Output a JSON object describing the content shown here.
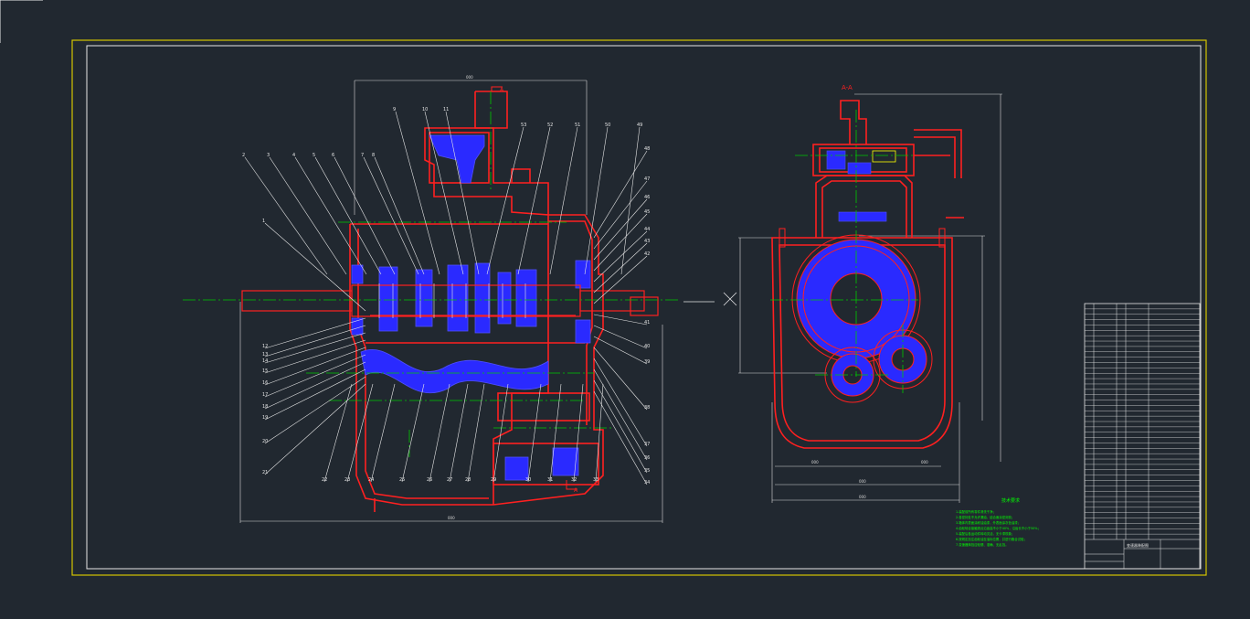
{
  "colors": {
    "background": "#212830",
    "frame_outer": "#d4c400",
    "frame_inner": "#e6e6e6",
    "housing": "#ff2020",
    "gear": "#3a3aff",
    "center": "#00c800",
    "dim": "#d8d8d8",
    "leader": "#e6e6e6",
    "notes": "#00ff00",
    "oil": "#00e0ff"
  },
  "section": {
    "label": "A-A",
    "marker_top": "A",
    "marker_bottom": "A"
  },
  "part_numbers": {
    "top_row": [
      "2",
      "3",
      "4",
      "5",
      "6",
      "7",
      "8",
      "9",
      "10",
      "11"
    ],
    "top_row_right": [
      "53",
      "52",
      "51",
      "50",
      "49"
    ],
    "left_col": [
      "1",
      "12",
      "13",
      "14",
      "15",
      "16",
      "17",
      "18",
      "19",
      "20",
      "21"
    ],
    "bottom_row": [
      "22",
      "23",
      "24",
      "25",
      "26",
      "27",
      "28",
      "29",
      "30",
      "31",
      "32",
      "33"
    ],
    "right_col": [
      "48",
      "47",
      "46",
      "45",
      "44",
      "43",
      "42",
      "41",
      "40",
      "39",
      "38",
      "37",
      "36",
      "35",
      "34"
    ]
  },
  "notes": {
    "title": "技术要求",
    "lines": [
      "1.装配前所有零件清洗干净；",
      "2.各密封处不允许漏油，结合面涂密封胶；",
      "3.箱体内表面涂耐油油漆，外表面涂灰色油漆；",
      "4.齿轮啮合接触斑点沿齿高不小于40%，沿齿长不小于50%；",
      "5.装配后各运动件转动灵活，无卡滞现象；",
      "6.按规定加注齿轮油至油标位置，并进行跑合试验；",
      "7.变速器换挡应轻便、准确、无乱挡。"
    ]
  },
  "title_block": {
    "drawing_name": "变速器装配图",
    "org": "",
    "rows": 44
  }
}
